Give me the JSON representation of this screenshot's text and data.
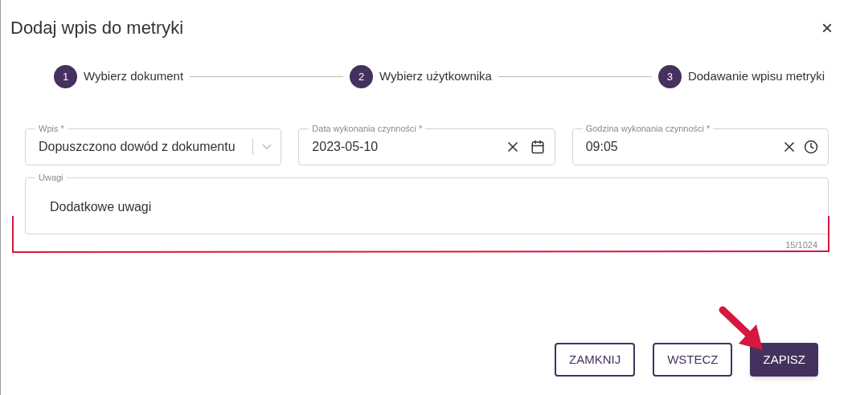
{
  "dialog": {
    "title": "Dodaj wpis do metryki",
    "close": "×"
  },
  "steps": [
    {
      "number": "1",
      "label": "Wybierz dokument"
    },
    {
      "number": "2",
      "label": "Wybierz użytkownika"
    },
    {
      "number": "3",
      "label": "Dodawanie wpisu metryki"
    }
  ],
  "fields": [
    {
      "kind": "select",
      "label": "Wpis *",
      "value": "Dopuszczono dowód z dokumentu"
    },
    {
      "kind": "date",
      "label": "Data wykonania czynności *",
      "value": "2023-05-10"
    },
    {
      "kind": "time",
      "label": "Godzina wykonania czynności *",
      "value": "09:05"
    }
  ],
  "notes": {
    "label": "Uwagi",
    "value": "Dodatkowe uwagi",
    "counter": "15/1024"
  },
  "buttons": [
    {
      "label": "ZAMKNIJ",
      "kind": "outline"
    },
    {
      "label": "WSTECZ",
      "kind": "outline"
    },
    {
      "label": "ZAPISZ",
      "kind": "primary"
    }
  ]
}
